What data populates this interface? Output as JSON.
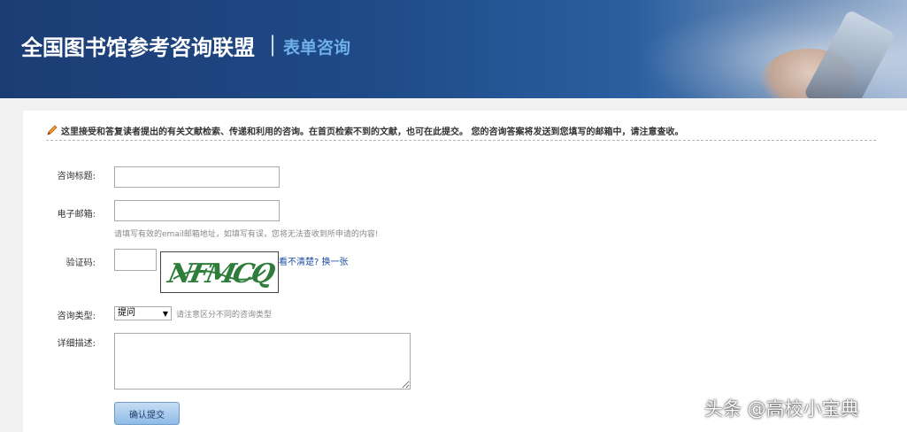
{
  "header": {
    "title": "全国图书馆参考咨询联盟",
    "separator": "|",
    "subtitle": "表单咨询"
  },
  "notice": {
    "icon": "pencil-icon",
    "text": "这里接受和答复读者提出的有关文献检索、传递和利用的咨询。在首页检索不到的文献，也可在此提交。  您的咨询答案将发送到您填写的邮箱中，请注意查收。"
  },
  "form": {
    "subject": {
      "label": "咨询标题:",
      "value": ""
    },
    "email": {
      "label": "电子邮箱:",
      "value": "",
      "hint": "请填写有效的email邮箱地址，如填写有误，您将无法查收到所申请的内容!"
    },
    "captcha": {
      "label": "验证码:",
      "value": "",
      "image_text": "NFMCQ",
      "refresh_link": "看不清楚? 换一张"
    },
    "type": {
      "label": "咨询类型:",
      "selected": "提问",
      "hint": "请注意区分不同的咨询类型"
    },
    "details": {
      "label": "详细描述:",
      "value": ""
    },
    "submit_label": "确认提交"
  },
  "watermark": "头条 @高校小宝典",
  "colors": {
    "banner_dark": "#1c3c74",
    "subtitle": "#6fb0ea",
    "link": "#1f4ea3",
    "captcha_text": "#2e7d3a",
    "button": "#8fbbe6"
  }
}
